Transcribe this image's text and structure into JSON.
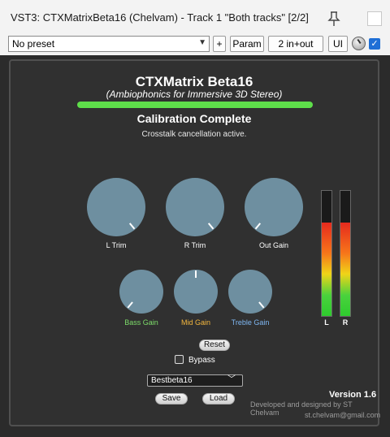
{
  "window": {
    "title": "VST3: CTXMatrixBeta16 (Chelvam) - Track 1 \"Both tracks\" [2/2]",
    "icons": {
      "pin": "pin-icon",
      "close": "close-icon"
    }
  },
  "toolbar": {
    "preset_value": "No preset",
    "plus_label": "+",
    "param_label": "Param",
    "io_label": "2 in+out",
    "ui_label": "UI",
    "wet_knob": "dial-icon",
    "enabled_checked": true
  },
  "plugin": {
    "title": "CTXMatrix Beta16",
    "subtitle": "(Ambiophonics for Immersive 3D Stereo)",
    "calibration_progress": 1.0,
    "calibration_status": "Calibration Complete",
    "status_text": "Crosstalk cancellation active.",
    "knobs_large": [
      {
        "label": "L Trim",
        "angle_deg": 140,
        "color": "#ffffff"
      },
      {
        "label": "R Trim",
        "angle_deg": 140,
        "color": "#ffffff"
      },
      {
        "label": "Out Gain",
        "angle_deg": -140,
        "color": "#ffffff"
      }
    ],
    "knobs_small": [
      {
        "label": "Bass Gain",
        "angle_deg": -140,
        "color": "#7ddc6a"
      },
      {
        "label": "Mid Gain",
        "angle_deg": 0,
        "color": "#f3b73e"
      },
      {
        "label": "Treble Gain",
        "angle_deg": 140,
        "color": "#7fb7f2"
      }
    ],
    "meters": [
      {
        "label": "L",
        "level": 0.75
      },
      {
        "label": "R",
        "level": 0.75
      }
    ],
    "reset_label": "Reset",
    "bypass_label": "Bypass",
    "bypass_checked": false,
    "preset_select": "Bestbeta16",
    "save_label": "Save",
    "load_label": "Load",
    "version": "Version 1.6",
    "credit": "Developed and designed by ST Chelvam",
    "email": "st.chelvam@gmail.com"
  },
  "colors": {
    "background": "#303030",
    "progress": "#5ede4a",
    "knob": "#6e8fa0",
    "checkbox_accent": "#1f6fd6"
  }
}
